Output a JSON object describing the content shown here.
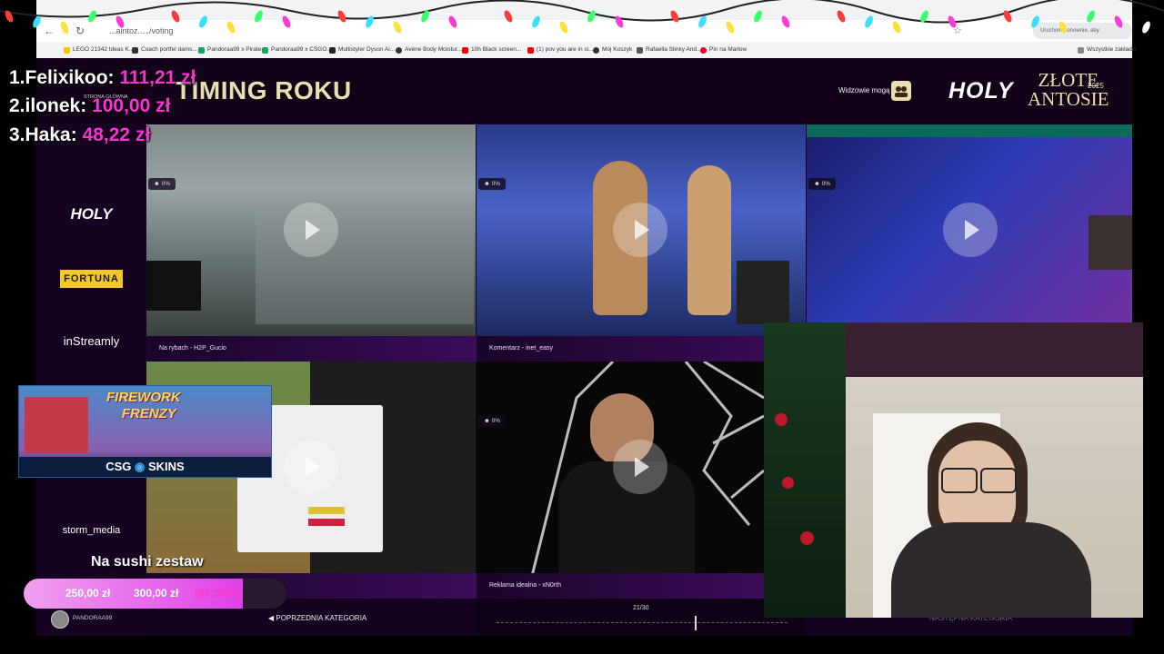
{
  "browser": {
    "url": "...aintoz...9/voting",
    "update_notice": "Uruchom ponownie, aby zaktualizować",
    "bookmarks": [
      "LEGO 21342 Ideas K...",
      "Coach portfel dams...",
      "Pandoraa99 x Pirate...",
      "Pandoraa99 x CSGO...",
      "Multistyler Dyson Ai...",
      "Avène Body Moistur...",
      "10h Black screen...",
      "(1) pov you are in sl...",
      "Mój Koszyk",
      "Rafaella Slinky And...",
      "Pin na Marlow"
    ],
    "all_bookmarks": "Wszystkie zakładki"
  },
  "leaderboard": [
    {
      "rank": "1.",
      "name": "Felixikoo:",
      "amount": "111,21 zł"
    },
    {
      "rank": "2.",
      "name": "ilonek:",
      "amount": "100,00 zł"
    },
    {
      "rank": "3.",
      "name": "Haka:",
      "amount": "48,22 zł"
    }
  ],
  "header": {
    "title": "TIMING ROKU",
    "home_label": "STRONA GŁÓWNA",
    "viewers_label": "Widzowie mogą",
    "brand_logo": "HOLY",
    "event_logo_line1": "ZŁOTE",
    "event_logo_line2": "ANTOSIE",
    "event_year": "2025"
  },
  "sponsors": [
    "HOLY",
    "FORTUNA",
    "inStreamly",
    "storm_media"
  ],
  "videos": [
    {
      "caption": "Na rybach - H2P_Gucio",
      "percent": "0%"
    },
    {
      "caption": "Komentarz - inet_easy",
      "percent": "0%"
    },
    {
      "caption": "",
      "percent": "0%"
    },
    {
      "caption": "",
      "percent": ""
    },
    {
      "caption": "Reklama idealna - xN0rth",
      "percent": "0%"
    }
  ],
  "navigation": {
    "prev": "POPRZEDNIA KATEGORIA",
    "next": "NASTĘPNA KATEGORIA",
    "counter": "21/30"
  },
  "ad": {
    "game_title_line1": "FIREWORK",
    "game_title_line2": "FRENZY",
    "brand_left": "CSG",
    "brand_right": "SKINS"
  },
  "goal": {
    "label": "Na sushi zestaw",
    "current": "250,00 zł",
    "target": "300,00 zł",
    "percent_text": "(83,33%)",
    "progress": 0.8333
  },
  "streamer": {
    "name": "PANDORAA99"
  },
  "colors": {
    "accent": "#ff2fd7",
    "page_bg": "#12031c",
    "goal_bar": "#e040e8"
  }
}
